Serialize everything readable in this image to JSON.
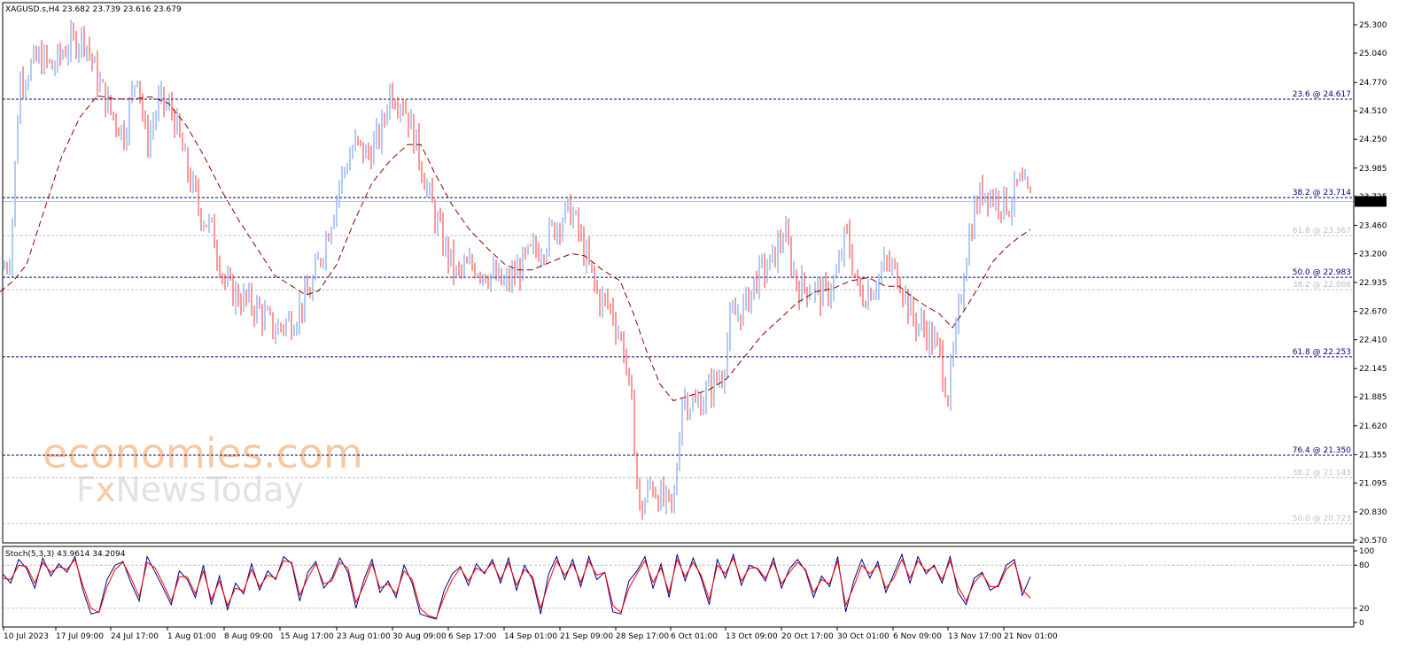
{
  "symbol_header": "XAGUSD.s,H4  23.682 23.739 23.616 23.679",
  "stoch_header": "Stoch(5,3,3) 43.9614 34.2094",
  "current_price_label": "23.679",
  "watermark": {
    "line1": "economies.com",
    "line2_left": "F",
    "line2_x": "x",
    "line2_right": "NewsToday"
  },
  "colors": {
    "bull": "#6495ed",
    "bear": "#ff3030",
    "ma": "#8b0000",
    "fib_main": "#000080",
    "fib_sec": "#c0c0c0",
    "stoch_main": "#00008b",
    "stoch_signal": "#ff0000"
  },
  "chart_data": [
    {
      "type": "candlestick",
      "title": "XAGUSD.s,H4",
      "ylim": [
        20.57,
        25.3
      ],
      "y_ticks": [
        "25.300",
        "25.040",
        "24.770",
        "24.510",
        "24.250",
        "23.985",
        "23.725",
        "23.460",
        "23.200",
        "22.935",
        "22.670",
        "22.410",
        "22.145",
        "21.885",
        "21.620",
        "21.355",
        "21.095",
        "20.830",
        "20.570"
      ],
      "x_labels": [
        "10 Jul 2023",
        "17 Jul 09:00",
        "24 Jul 17:00",
        "1 Aug 01:00",
        "8 Aug 09:00",
        "15 Aug 17:00",
        "23 Aug 01:00",
        "30 Aug 09:00",
        "6 Sep 17:00",
        "14 Sep 01:00",
        "21 Sep 09:00",
        "28 Sep 17:00",
        "6 Oct 01:00",
        "13 Oct 09:00",
        "20 Oct 17:00",
        "30 Oct 01:00",
        "6 Nov 09:00",
        "13 Nov 17:00",
        "21 Nov 01:00"
      ],
      "close_path": [
        [
          0,
          23.0
        ],
        [
          12,
          23.2
        ],
        [
          22,
          24.8
        ],
        [
          45,
          25.0
        ],
        [
          60,
          24.9
        ],
        [
          75,
          25.1
        ],
        [
          95,
          25.2
        ],
        [
          110,
          24.8
        ],
        [
          125,
          24.5
        ],
        [
          140,
          24.3
        ],
        [
          155,
          24.9
        ],
        [
          165,
          24.2
        ],
        [
          180,
          24.6
        ],
        [
          195,
          24.5
        ],
        [
          210,
          24.0
        ],
        [
          225,
          23.6
        ],
        [
          240,
          23.4
        ],
        [
          255,
          22.9
        ],
        [
          270,
          22.8
        ],
        [
          290,
          22.7
        ],
        [
          310,
          22.5
        ],
        [
          330,
          22.6
        ],
        [
          350,
          22.85
        ],
        [
          370,
          23.4
        ],
        [
          385,
          23.9
        ],
        [
          400,
          24.2
        ],
        [
          415,
          24.1
        ],
        [
          430,
          24.3
        ],
        [
          440,
          24.7
        ],
        [
          455,
          24.6
        ],
        [
          470,
          24.2
        ],
        [
          485,
          23.7
        ],
        [
          500,
          23.3
        ],
        [
          515,
          23.0
        ],
        [
          535,
          23.1
        ],
        [
          555,
          23.0
        ],
        [
          570,
          22.9
        ],
        [
          585,
          23.05
        ],
        [
          600,
          23.2
        ],
        [
          615,
          23.3
        ],
        [
          630,
          23.5
        ],
        [
          645,
          23.6
        ],
        [
          660,
          23.2
        ],
        [
          675,
          22.8
        ],
        [
          690,
          22.7
        ],
        [
          705,
          22.3
        ],
        [
          715,
          21.6
        ],
        [
          722,
          20.8
        ],
        [
          735,
          21.1
        ],
        [
          750,
          20.9
        ],
        [
          760,
          20.85
        ],
        [
          770,
          21.9
        ],
        [
          785,
          21.8
        ],
        [
          800,
          21.95
        ],
        [
          815,
          22.1
        ],
        [
          825,
          22.6
        ],
        [
          840,
          22.7
        ],
        [
          855,
          23.0
        ],
        [
          870,
          23.1
        ],
        [
          885,
          23.4
        ],
        [
          900,
          22.9
        ],
        [
          915,
          22.9
        ],
        [
          930,
          22.8
        ],
        [
          945,
          23.0
        ],
        [
          955,
          23.4
        ],
        [
          970,
          22.8
        ],
        [
          985,
          22.9
        ],
        [
          1000,
          23.1
        ],
        [
          1015,
          23.0
        ],
        [
          1030,
          22.6
        ],
        [
          1045,
          22.5
        ],
        [
          1060,
          22.3
        ],
        [
          1070,
          21.9
        ],
        [
          1080,
          22.5
        ],
        [
          1090,
          23.2
        ],
        [
          1100,
          23.6
        ],
        [
          1110,
          23.8
        ],
        [
          1125,
          23.7
        ],
        [
          1140,
          23.65
        ],
        [
          1150,
          23.85
        ],
        [
          1163,
          23.68
        ]
      ],
      "ma_path": [
        [
          0,
          22.85
        ],
        [
          15,
          22.95
        ],
        [
          30,
          23.1
        ],
        [
          50,
          23.6
        ],
        [
          70,
          24.1
        ],
        [
          90,
          24.45
        ],
        [
          110,
          24.65
        ],
        [
          130,
          24.62
        ],
        [
          150,
          24.62
        ],
        [
          170,
          24.64
        ],
        [
          190,
          24.58
        ],
        [
          210,
          24.38
        ],
        [
          230,
          24.1
        ],
        [
          250,
          23.78
        ],
        [
          270,
          23.5
        ],
        [
          290,
          23.25
        ],
        [
          310,
          23.0
        ],
        [
          330,
          22.9
        ],
        [
          345,
          22.82
        ],
        [
          360,
          22.86
        ],
        [
          380,
          23.1
        ],
        [
          400,
          23.5
        ],
        [
          420,
          23.85
        ],
        [
          440,
          24.05
        ],
        [
          460,
          24.2
        ],
        [
          475,
          24.2
        ],
        [
          490,
          23.95
        ],
        [
          510,
          23.65
        ],
        [
          530,
          23.42
        ],
        [
          550,
          23.25
        ],
        [
          570,
          23.1
        ],
        [
          585,
          23.05
        ],
        [
          600,
          23.05
        ],
        [
          615,
          23.1
        ],
        [
          630,
          23.15
        ],
        [
          645,
          23.2
        ],
        [
          660,
          23.18
        ],
        [
          680,
          23.05
        ],
        [
          700,
          22.95
        ],
        [
          715,
          22.65
        ],
        [
          730,
          22.3
        ],
        [
          745,
          22.0
        ],
        [
          760,
          21.85
        ],
        [
          780,
          21.9
        ],
        [
          800,
          21.95
        ],
        [
          820,
          22.05
        ],
        [
          840,
          22.25
        ],
        [
          860,
          22.45
        ],
        [
          880,
          22.6
        ],
        [
          900,
          22.75
        ],
        [
          920,
          22.85
        ],
        [
          940,
          22.88
        ],
        [
          960,
          22.95
        ],
        [
          980,
          22.98
        ],
        [
          1000,
          22.9
        ],
        [
          1015,
          22.9
        ],
        [
          1030,
          22.8
        ],
        [
          1045,
          22.72
        ],
        [
          1060,
          22.65
        ],
        [
          1075,
          22.52
        ],
        [
          1090,
          22.7
        ],
        [
          1105,
          22.9
        ],
        [
          1120,
          23.12
        ],
        [
          1135,
          23.25
        ],
        [
          1150,
          23.35
        ],
        [
          1163,
          23.42
        ]
      ],
      "fib_levels": [
        {
          "label": "23.6 @ 24.617",
          "value": 24.617,
          "style": "main"
        },
        {
          "label": "38.2 @ 23.714",
          "value": 23.714,
          "style": "main"
        },
        {
          "label": "61.8 @ 23.367",
          "value": 23.367,
          "style": "secondary"
        },
        {
          "label": "50.0 @ 22.983",
          "value": 22.983,
          "style": "main"
        },
        {
          "label": "38.2 @ 22.868",
          "value": 22.868,
          "style": "secondary"
        },
        {
          "label": "61.8 @ 22.253",
          "value": 22.253,
          "style": "main"
        },
        {
          "label": "76.4 @ 21.350",
          "value": 21.35,
          "style": "main"
        },
        {
          "label": "38.2 @ 21.143",
          "value": 21.143,
          "style": "secondary"
        },
        {
          "label": "50.0 @ 20.723",
          "value": 20.723,
          "style": "secondary"
        }
      ],
      "current_price": 23.679
    },
    {
      "type": "line",
      "title": "Stoch(5,3,3) 43.9614 34.2094",
      "ylim": [
        0,
        100
      ],
      "y_ticks": [
        "100",
        "80",
        "20",
        "0"
      ],
      "levels": [
        80,
        20
      ],
      "series": [
        {
          "name": "main",
          "values": [
            68,
            55,
            88,
            75,
            48,
            90,
            65,
            82,
            70,
            92,
            45,
            12,
            15,
            60,
            80,
            85,
            55,
            30,
            92,
            70,
            48,
            25,
            72,
            60,
            35,
            80,
            25,
            65,
            18,
            55,
            40,
            82,
            45,
            72,
            60,
            92,
            82,
            30,
            70,
            85,
            48,
            62,
            90,
            70,
            20,
            60,
            88,
            42,
            58,
            35,
            80,
            55,
            12,
            8,
            5,
            45,
            68,
            78,
            52,
            82,
            68,
            88,
            55,
            90,
            45,
            80,
            60,
            12,
            68,
            92,
            60,
            88,
            50,
            92,
            60,
            70,
            15,
            12,
            58,
            72,
            92,
            48,
            82,
            35,
            95,
            58,
            90,
            62,
            25,
            88,
            62,
            95,
            52,
            80,
            75,
            58,
            90,
            48,
            75,
            88,
            72,
            35,
            65,
            50,
            92,
            15,
            58,
            88,
            62,
            85,
            42,
            68,
            95,
            55,
            92,
            68,
            80,
            55,
            92,
            42,
            25,
            62,
            70,
            45,
            52,
            80,
            88,
            38,
            64
          ]
        },
        {
          "name": "signal",
          "values": [
            62,
            60,
            80,
            78,
            55,
            84,
            70,
            78,
            74,
            88,
            52,
            20,
            14,
            50,
            74,
            84,
            62,
            36,
            84,
            76,
            54,
            30,
            64,
            64,
            40,
            72,
            32,
            58,
            24,
            48,
            44,
            74,
            50,
            66,
            62,
            86,
            84,
            38,
            62,
            82,
            54,
            58,
            84,
            76,
            28,
            52,
            82,
            48,
            54,
            40,
            72,
            60,
            20,
            10,
            6,
            36,
            60,
            76,
            58,
            76,
            70,
            84,
            60,
            84,
            52,
            74,
            64,
            20,
            56,
            86,
            66,
            82,
            56,
            86,
            66,
            70,
            24,
            14,
            48,
            68,
            86,
            56,
            76,
            42,
            88,
            64,
            84,
            66,
            32,
            80,
            68,
            90,
            58,
            76,
            76,
            62,
            84,
            54,
            70,
            84,
            74,
            42,
            60,
            54,
            86,
            24,
            50,
            80,
            68,
            80,
            48,
            62,
            88,
            62,
            86,
            72,
            78,
            60,
            86,
            50,
            30,
            56,
            68,
            50,
            50,
            74,
            84,
            46,
            34
          ]
        }
      ]
    }
  ]
}
